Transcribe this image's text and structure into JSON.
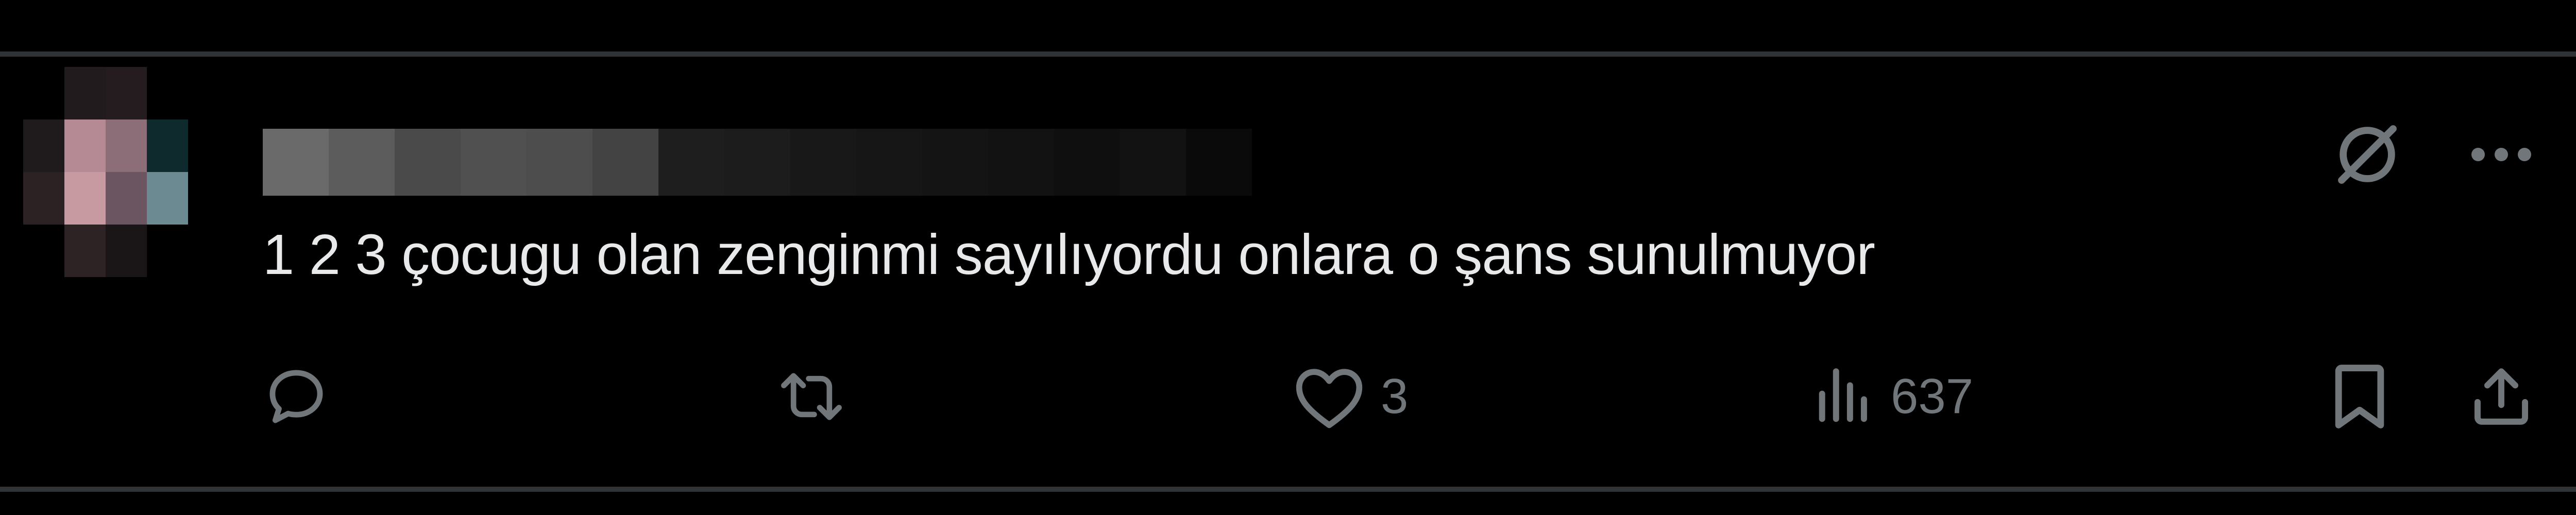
{
  "colors": {
    "background": "#000000",
    "divider": "#2f3336",
    "text_primary": "#e7e9ea",
    "text_secondary": "#71767b"
  },
  "tweet": {
    "text": "1 2 3 çocugu olan zenginmi sayılıyordu onlara o şans sunulmuyor"
  },
  "top_actions": {
    "grok_icon": "grok-icon",
    "more_icon": "more-icon"
  },
  "actions": {
    "reply": {
      "icon": "reply-icon",
      "count": ""
    },
    "retweet": {
      "icon": "retweet-icon",
      "count": ""
    },
    "like": {
      "icon": "heart-icon",
      "count": "3"
    },
    "views": {
      "icon": "views-icon",
      "count": "637"
    },
    "bookmark": {
      "icon": "bookmark-icon"
    },
    "share": {
      "icon": "share-icon"
    }
  }
}
